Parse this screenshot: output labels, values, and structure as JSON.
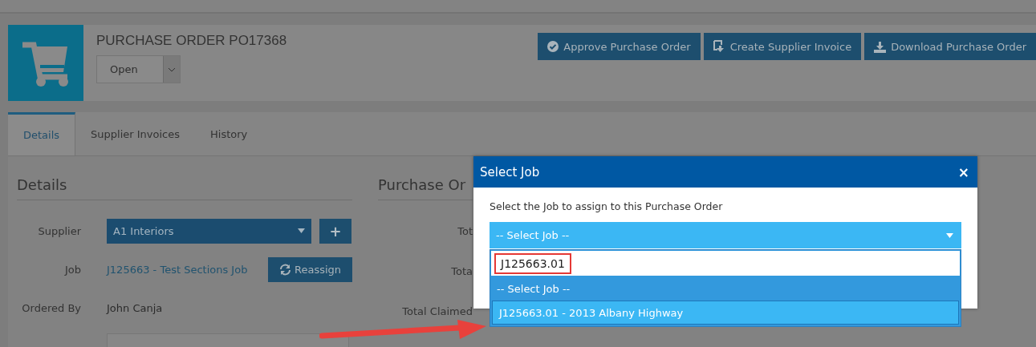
{
  "header": {
    "title": "PURCHASE ORDER PO17368",
    "status": "Open"
  },
  "actions": [
    {
      "label": "Approve Purchase Order",
      "kind": "check"
    },
    {
      "label": "Create Supplier Invoice",
      "kind": "invoice"
    },
    {
      "label": "Download Purchase Order",
      "kind": "download"
    }
  ],
  "tabs": [
    {
      "label": "Details",
      "selected": true
    },
    {
      "label": "Supplier Invoices",
      "selected": false
    },
    {
      "label": "History",
      "selected": false
    }
  ],
  "details": {
    "heading": "Details",
    "fields": [
      {
        "label": "Supplier",
        "kind": "select",
        "value": "A1 Interiors",
        "action": "+"
      },
      {
        "label": "Job",
        "kind": "link",
        "value": "J125663 - Test Sections Job",
        "action": "Reassign"
      },
      {
        "label": "Ordered By",
        "kind": "text",
        "value": "John Canja"
      }
    ]
  },
  "summary": {
    "heading": "Purchase Or",
    "labels": [
      "Tot",
      "Tota",
      "Total Claimed"
    ]
  },
  "modal": {
    "title": "Select Job",
    "close": "×",
    "prompt": "Select the Job to assign to this Purchase Order",
    "select": "-- Select Job --",
    "search": "J125663.01",
    "options": [
      {
        "label": "-- Select Job --",
        "selected": false
      },
      {
        "label": "J125663.01 - 2013 Albany Highway",
        "selected": true
      }
    ]
  }
}
